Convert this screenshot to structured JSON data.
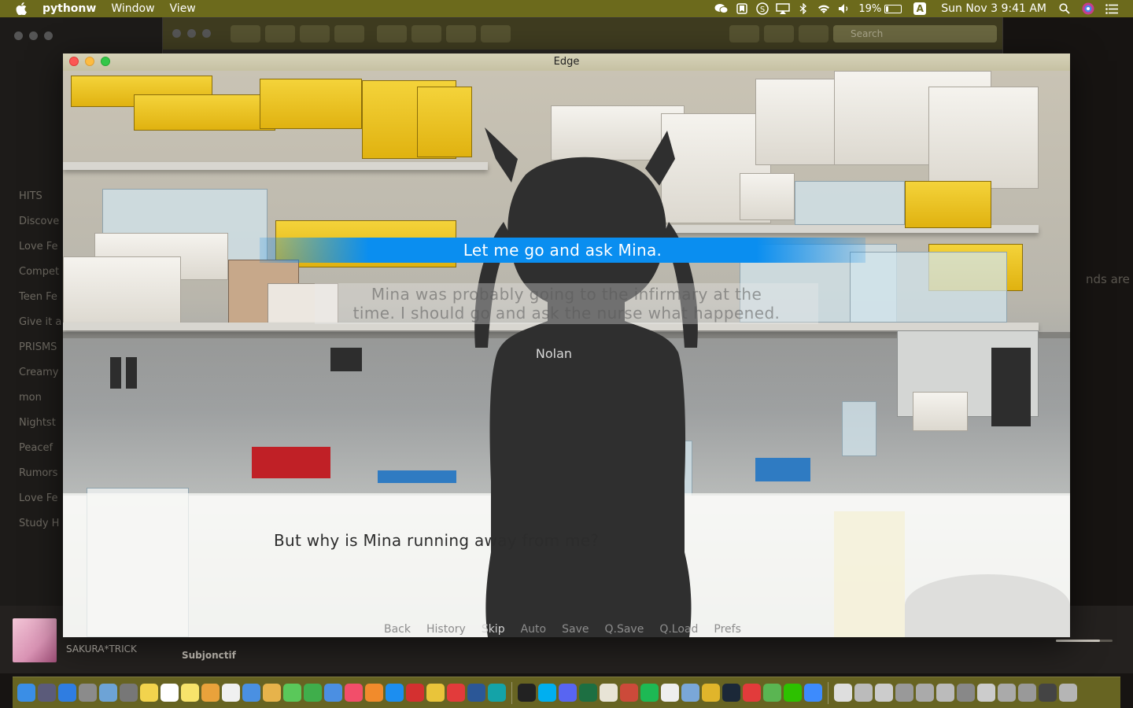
{
  "menubar": {
    "app_name": "pythonw",
    "menus": [
      "Window",
      "View"
    ],
    "battery_percent": "19%",
    "datetime": "Sun Nov 3  9:41 AM",
    "input_source": "A"
  },
  "background_app": {
    "search_placeholder": "Search",
    "sidebar_items": [
      "HITS",
      "Discove",
      "Love Fe",
      "Compet",
      "Teen Fe",
      "Give it a",
      "PRISMS",
      "Creamy",
      "mon",
      "Nightst",
      "Peacef",
      "Rumors",
      "Love Fe",
      "Study H"
    ],
    "right_text": "nds are",
    "song_name": "SAKURA*TRICK",
    "subtitle": "Subjonctif",
    "volume_level": 0.78
  },
  "game": {
    "window_title": "Edge",
    "choice": "Let me go and ask Mina.",
    "ghost_line_1": "Mina was probably going to the infirmary at the",
    "ghost_line_2": "time. I should go and ask the nurse what happened.",
    "ghost_speaker": "Nolan",
    "dialogue": "But why is Mina running away from me?",
    "quick_menu": {
      "back": "Back",
      "history": "History",
      "skip": "Skip",
      "auto": "Auto",
      "save": "Save",
      "qsave": "Q.Save",
      "qload": "Q.Load",
      "prefs": "Prefs"
    }
  },
  "colors": {
    "menubar": "#6c6a1c",
    "choice_highlight": "#0a8ef0",
    "dock": "#767226"
  },
  "dock_icons": [
    "finder-icon",
    "launchpad-icon",
    "safari-icon",
    "rocket-icon",
    "preview-icon",
    "system-preferences-icon",
    "notes-icon",
    "calendar-icon",
    "stickies-icon",
    "photos-icon",
    "textedit-icon",
    "mail-icon",
    "sketchbook-icon",
    "messages-icon",
    "numbers-icon",
    "keynote-icon",
    "music-icon",
    "books-icon",
    "app-store-icon",
    "autocad-icon",
    "chrome-icon",
    "netease-music-icon",
    "word-icon",
    "arduino-icon",
    "terminal-icon",
    "skype-icon",
    "discord-icon",
    "excel-icon",
    "scrivener-icon",
    "mahjong-icon",
    "spotify-icon",
    "typora-icon",
    "screen-sharing-icon",
    "trophy-icon",
    "steam-icon",
    "flashcards-icon",
    "kakao-icon",
    "wechat-icon",
    "downloads-icon",
    "documents-icon",
    "window-icon-1",
    "window-icon-2",
    "window-icon-3",
    "window-icon-4",
    "window-icon-5",
    "window-icon-6",
    "window-icon-7",
    "window-icon-8",
    "window-icon-9",
    "window-icon-10",
    "trash-icon"
  ]
}
